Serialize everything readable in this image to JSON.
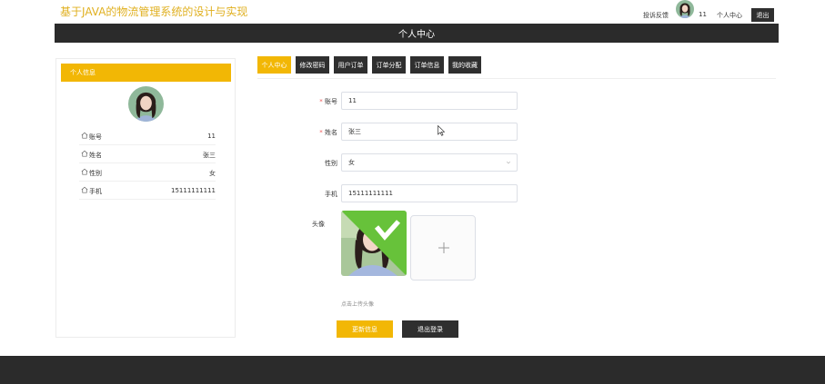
{
  "header": {
    "site_title": "基于JAVA的物流管理系统的设计与实现",
    "feedback_link": "投诉反馈",
    "username": "11",
    "profile_link": "个人中心",
    "logout_label": "退出"
  },
  "banner": {
    "title": "个人中心"
  },
  "sidebar": {
    "heading": "个人信息",
    "rows": [
      {
        "label": "账号",
        "value": "11"
      },
      {
        "label": "姓名",
        "value": "张三"
      },
      {
        "label": "性别",
        "value": "女"
      },
      {
        "label": "手机",
        "value": "15111111111"
      }
    ]
  },
  "tabs": [
    {
      "label": "个人中心",
      "active": true
    },
    {
      "label": "修改密码",
      "active": false
    },
    {
      "label": "用户订单",
      "active": false
    },
    {
      "label": "订单分配",
      "active": false
    },
    {
      "label": "订单信息",
      "active": false
    },
    {
      "label": "我的收藏",
      "active": false
    }
  ],
  "form": {
    "account": {
      "label": "账号",
      "value": "11",
      "required": "*"
    },
    "name": {
      "label": "姓名",
      "value": "张三",
      "required": "*"
    },
    "gender": {
      "label": "性别",
      "value": "女"
    },
    "phone": {
      "label": "手机",
      "value": "15111111111"
    },
    "avatar": {
      "label": "头像",
      "hint": "点击上传头像"
    },
    "update_button": "更新信息",
    "logout_button": "退出登录"
  },
  "colors": {
    "accent": "#f2b705",
    "dark": "#2f2f2f",
    "banner": "#2b2b2b"
  }
}
